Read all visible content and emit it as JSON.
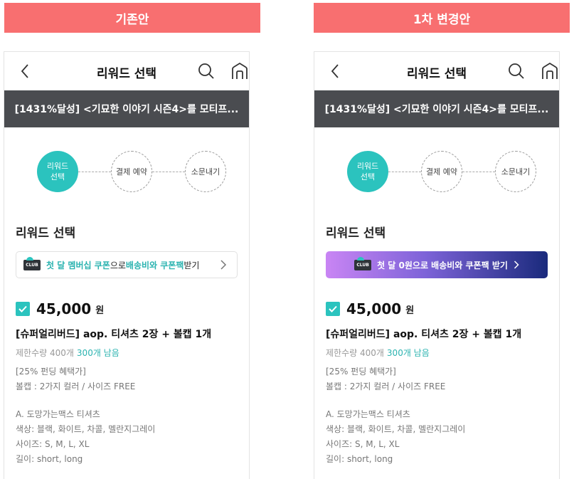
{
  "labels": {
    "left": "기존안",
    "right": "1차 변경안"
  },
  "header": {
    "title": "리워드 선택"
  },
  "banner": {
    "text": "[1431%달성] <기묘한 이야기 시즌4>를 모티프..."
  },
  "steps": [
    "리워드\n선택",
    "결제 예약",
    "소문내기"
  ],
  "section_title": "리워드 선택",
  "coupon_original": {
    "badge": "CLUB",
    "part1": "첫 달 멤버십 쿠폰",
    "part2": "으로 ",
    "part3": "배송비와 쿠폰팩",
    "part4": " 받기"
  },
  "coupon_revised": {
    "badge": "CLUB",
    "text": "첫 달 0원으로 배송비와 쿠폰팩 받기"
  },
  "reward": {
    "price": "45,000",
    "unit": "원",
    "name": "[슈퍼얼리버드] aop. 티셔츠 2장 + 볼캡 1개",
    "limit_label": "제한수량 400개",
    "remaining": "300개 남음",
    "desc_lines": [
      "[25% 펀딩 혜택가]",
      "볼캡 : 2가지 컬러 / 사이즈 FREE"
    ],
    "option_lines": [
      "A. 도망가는맥스 티셔츠",
      "색상: 블랙, 화이트, 차콜, 멜란지그레이",
      "사이즈: S, M, L, XL",
      "길이: short, long"
    ]
  },
  "colors": {
    "label_bg": "#f86f70",
    "accent": "#2bc3be",
    "banner_bg": "#4a4c50"
  }
}
